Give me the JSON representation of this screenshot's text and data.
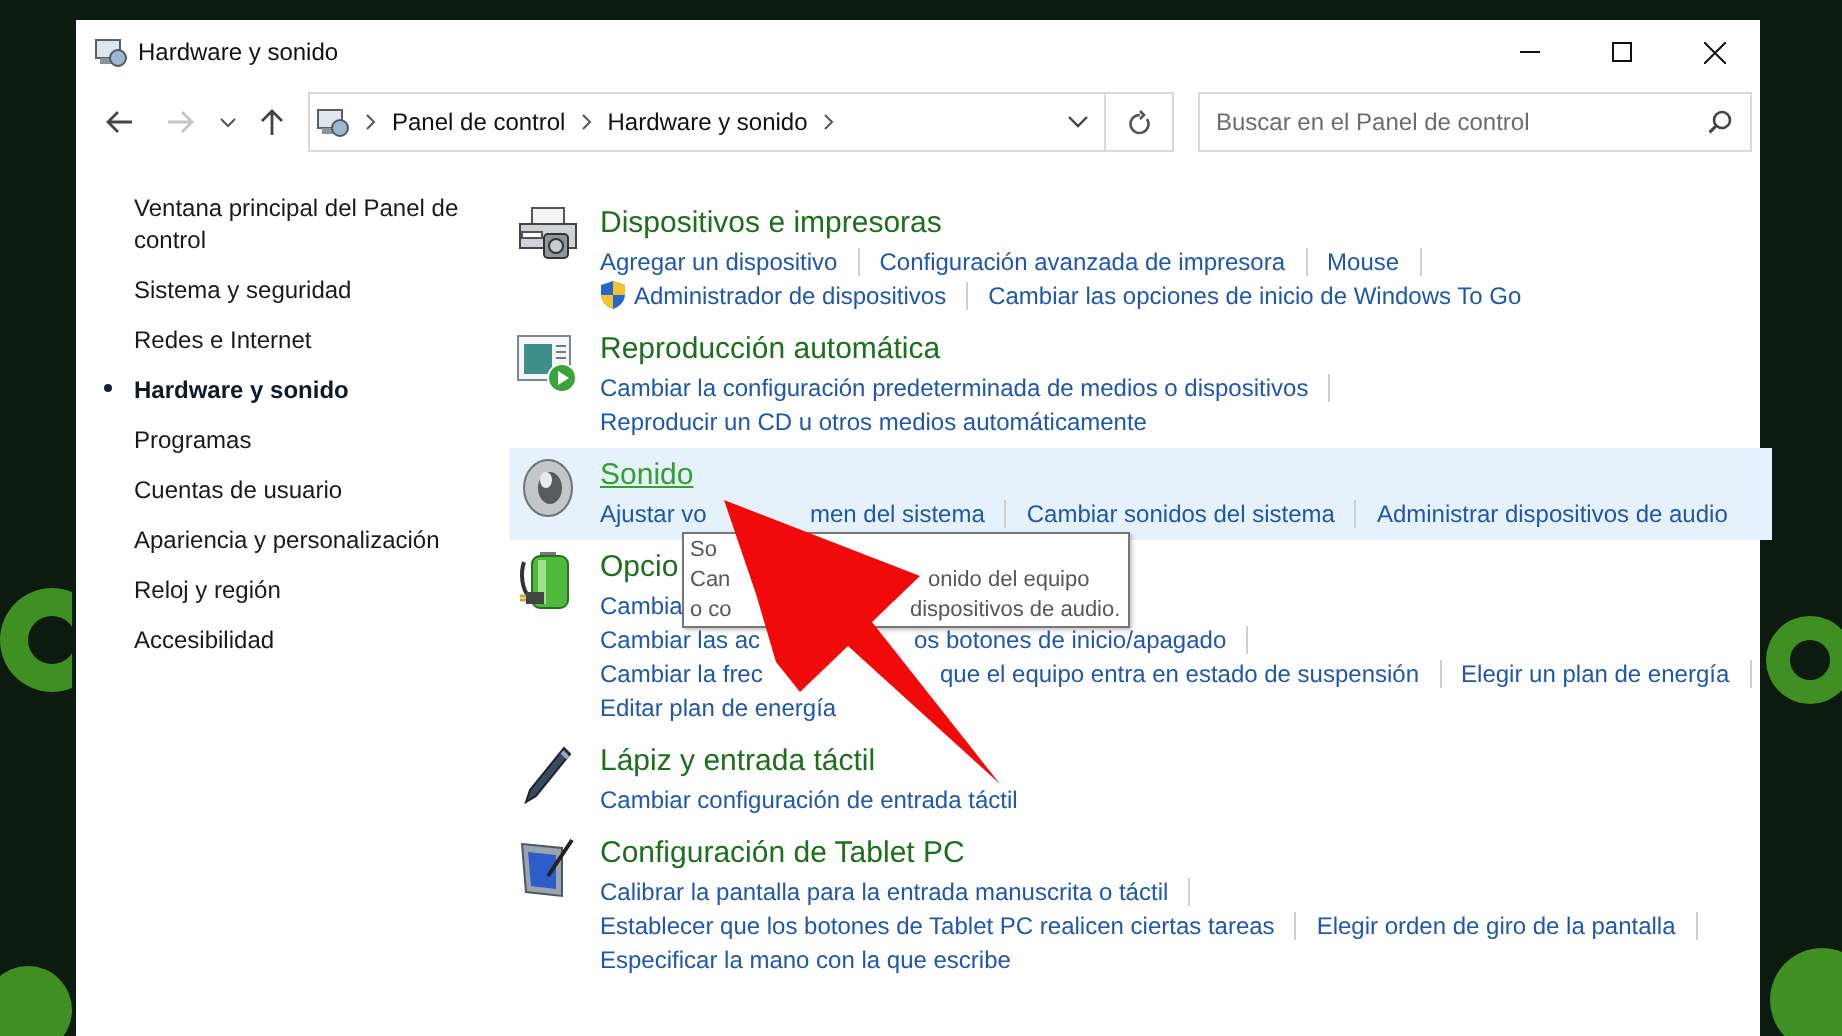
{
  "window": {
    "title": "Hardware y sonido"
  },
  "navigation": {
    "back": {
      "disabled": false
    },
    "forward": {
      "disabled": true
    }
  },
  "address_bar": {
    "crumbs": [
      "Panel de control",
      "Hardware y sonido"
    ]
  },
  "search": {
    "placeholder": "Buscar en el Panel de control"
  },
  "sidebar": {
    "items": [
      {
        "label": "Ventana principal del Panel de control",
        "selected": false
      },
      {
        "label": "Sistema y seguridad",
        "selected": false
      },
      {
        "label": "Redes e Internet",
        "selected": false
      },
      {
        "label": "Hardware y sonido",
        "selected": true
      },
      {
        "label": "Programas",
        "selected": false
      },
      {
        "label": "Cuentas de usuario",
        "selected": false
      },
      {
        "label": "Apariencia y personalización",
        "selected": false
      },
      {
        "label": "Reloj y región",
        "selected": false
      },
      {
        "label": "Accesibilidad",
        "selected": false
      }
    ]
  },
  "sections": [
    {
      "kind": "devices",
      "title": "Dispositivos e impresoras",
      "highlighted": false,
      "rows": [
        [
          {
            "parts": [
              "Agregar un dispositivo"
            ],
            "admin": false,
            "separator": true
          },
          {
            "parts": [
              "Configuración avanzada de impresora"
            ],
            "admin": false,
            "separator": true
          },
          {
            "parts": [
              "Mouse"
            ],
            "admin": false,
            "separator": true
          }
        ],
        [
          {
            "parts": [
              "Administrador de dispositivos"
            ],
            "admin": true,
            "separator": true
          },
          {
            "parts": [
              "Cambiar las opciones de inicio de Windows To Go"
            ],
            "admin": false,
            "separator": false
          }
        ]
      ]
    },
    {
      "kind": "autoplay",
      "title": "Reproducción automática",
      "highlighted": false,
      "rows": [
        [
          {
            "parts": [
              "Cambiar la configuración predeterminada de medios o dispositivos"
            ],
            "admin": false,
            "separator": true
          }
        ],
        [
          {
            "parts": [
              "Reproducir un CD u otros medios automáticamente"
            ],
            "admin": false,
            "separator": false
          }
        ]
      ]
    },
    {
      "kind": "sound",
      "title": "Sonido",
      "highlighted": true,
      "rows": [
        [
          {
            "parts": [
              "Ajustar vo",
              "men del sistema"
            ],
            "admin": false,
            "separator": true
          },
          {
            "parts": [
              "Cambiar sonidos del sistema"
            ],
            "admin": false,
            "separator": true
          },
          {
            "parts": [
              "Administrar dispositivos de audio"
            ],
            "admin": false,
            "separator": false
          }
        ]
      ]
    },
    {
      "kind": "power",
      "title": "Opcio",
      "highlighted": false,
      "rows": [
        [
          {
            "parts": [
              "Cambia"
            ],
            "admin": false,
            "separator": false
          }
        ],
        [
          {
            "parts": [
              "Cambiar las ac",
              "os botones de inicio/apagado"
            ],
            "admin": false,
            "separator": true
          }
        ],
        [
          {
            "parts": [
              "Cambiar la frec",
              "que el equipo entra en estado de suspensión"
            ],
            "admin": false,
            "separator": true
          },
          {
            "parts": [
              "Elegir un plan de energía"
            ],
            "admin": false,
            "separator": true
          }
        ],
        [
          {
            "parts": [
              "Editar plan de energía"
            ],
            "admin": false,
            "separator": false
          }
        ]
      ]
    },
    {
      "kind": "pen",
      "title": "Lápiz y entrada táctil",
      "highlighted": false,
      "rows": [
        [
          {
            "parts": [
              "Cambiar configuración de entrada táctil"
            ],
            "admin": false,
            "separator": false
          }
        ]
      ]
    },
    {
      "kind": "tablet",
      "title": "Configuración de Tablet PC",
      "highlighted": false,
      "rows": [
        [
          {
            "parts": [
              "Calibrar la pantalla para la entrada manuscrita o táctil"
            ],
            "admin": false,
            "separator": true
          }
        ],
        [
          {
            "parts": [
              "Establecer que los botones de Tablet PC realicen ciertas tareas"
            ],
            "admin": false,
            "separator": true
          },
          {
            "parts": [
              "Elegir orden de giro de la pantalla"
            ],
            "admin": false,
            "separator": true
          }
        ],
        [
          {
            "parts": [
              "Especificar la mano con la que escribe"
            ],
            "admin": false,
            "separator": false
          }
        ]
      ]
    }
  ],
  "tooltip": {
    "lines": [
      [
        "So"
      ],
      [
        "Can",
        "onido del equipo"
      ],
      [
        "o co",
        "dispositivos de audio."
      ]
    ]
  }
}
